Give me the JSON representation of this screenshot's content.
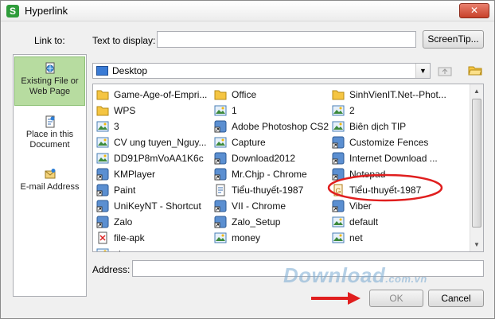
{
  "window": {
    "title": "Hyperlink",
    "app_icon": "S",
    "close_glyph": "✕"
  },
  "link_to_label": "Link to:",
  "text_to_display": {
    "label": "Text to display:",
    "value": ""
  },
  "screentip_label": "ScreenTip...",
  "link_options": [
    {
      "label": "Existing File or Web Page",
      "active": true,
      "icon": "globe-file-icon"
    },
    {
      "label": "Place in this Document",
      "active": false,
      "icon": "document-icon"
    },
    {
      "label": "E-mail Address",
      "active": false,
      "icon": "email-icon"
    }
  ],
  "location": {
    "value": "Desktop",
    "icon": "desktop-icon"
  },
  "files": [
    {
      "name": "Game-Age-of-Empri...",
      "icon": "folder-icon"
    },
    {
      "name": "Office",
      "icon": "folder-icon"
    },
    {
      "name": "SinhVienIT.Net--Phot...",
      "icon": "folder-icon"
    },
    {
      "name": "WPS",
      "icon": "folder-icon"
    },
    {
      "name": "1",
      "icon": "image-icon"
    },
    {
      "name": "2",
      "icon": "image-icon"
    },
    {
      "name": "3",
      "icon": "image-icon"
    },
    {
      "name": "Adobe Photoshop CS2",
      "icon": "shortcut-icon"
    },
    {
      "name": "Biên dịch TIP",
      "icon": "image-icon"
    },
    {
      "name": "CV ung tuyen_Nguy...",
      "icon": "image-icon"
    },
    {
      "name": "Capture",
      "icon": "image-icon"
    },
    {
      "name": "Customize Fences",
      "icon": "shortcut-icon"
    },
    {
      "name": "DD91P8mVoAA1K6c",
      "icon": "image-icon"
    },
    {
      "name": "Download2012",
      "icon": "shortcut-icon"
    },
    {
      "name": "Internet Download ...",
      "icon": "shortcut-icon"
    },
    {
      "name": "KMPlayer",
      "icon": "shortcut-icon"
    },
    {
      "name": "Mr.Chjp - Chrome",
      "icon": "shortcut-icon"
    },
    {
      "name": "Notepad",
      "icon": "shortcut-icon"
    },
    {
      "name": "Paint",
      "icon": "shortcut-icon"
    },
    {
      "name": "Tiểu-thuyết-1987",
      "icon": "document-icon"
    },
    {
      "name": "Tiểu-thuyết-1987",
      "icon": "text-document-icon"
    },
    {
      "name": "UniKeyNT - Shortcut",
      "icon": "shortcut-icon"
    },
    {
      "name": "VII - Chrome",
      "icon": "shortcut-icon"
    },
    {
      "name": "Viber",
      "icon": "shortcut-icon"
    },
    {
      "name": "Zalo",
      "icon": "shortcut-icon"
    },
    {
      "name": "Zalo_Setup",
      "icon": "shortcut-icon"
    },
    {
      "name": "default",
      "icon": "image-icon"
    },
    {
      "name": "file-apk",
      "icon": "file-icon"
    },
    {
      "name": "money",
      "icon": "image-icon"
    },
    {
      "name": "net",
      "icon": "image-icon"
    },
    {
      "name": "star",
      "icon": "image-icon"
    }
  ],
  "address": {
    "label": "Address:",
    "value": ""
  },
  "buttons": {
    "ok": "OK",
    "cancel": "Cancel"
  },
  "watermark": {
    "main": "Download",
    "suffix": ".com.vn"
  },
  "colors": {
    "highlight_circle": "#e01e1e",
    "arrow": "#e01e1e",
    "active_link": "#b7dca0"
  }
}
